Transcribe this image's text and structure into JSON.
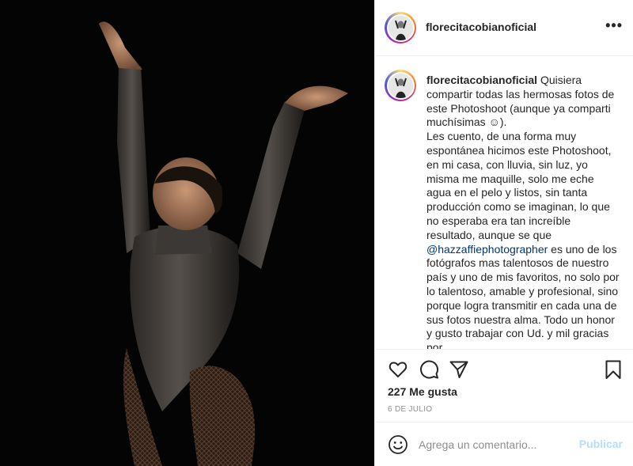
{
  "post": {
    "photo_icon": "photo-of-dancer",
    "header": {
      "username": "florecitacobianoficial",
      "more_icon": "more-dots-icon"
    },
    "caption": {
      "username": "florecitacobianoficial",
      "text_before_mention": "Quisiera compartir todas las hermosas fotos de este Photoshoot (aunque ya comparti muchísimas ☺).\nLes cuento, de una forma muy espontánea hicimos este Photoshoot, en mi casa, con lluvia, sin luz, yo misma me maquille, solo me eche agua en el pelo y listos, sin tanta producción como se imaginan, lo que no esperaba era tan increíble resultado, aunque se que ",
      "mention": "@hazzaffiephotographer",
      "text_after_mention": " es uno de los fotógrafos mas talentosos de nuestro país y uno de mis favoritos, no solo por lo talentoso, amable y profesional, sino porque logra transmitir en cada una de sus fotos nuestra alma. Todo un honor y gusto trabajar con Ud. y mil gracias por"
    },
    "actions": {
      "likes": "227 Me gusta",
      "date": "6 DE JULIO",
      "icons": [
        "heart-icon",
        "comment-icon",
        "share-icon",
        "bookmark-icon"
      ]
    },
    "comment": {
      "placeholder": "Agrega un comentario...",
      "publish_label": "Publicar",
      "emoji_icon": "emoji-icon"
    }
  },
  "colors": {
    "link": "#00376b",
    "publish_disabled": "#b2dffc",
    "secondary_text": "#8e8e8e",
    "border": "#efefef"
  }
}
